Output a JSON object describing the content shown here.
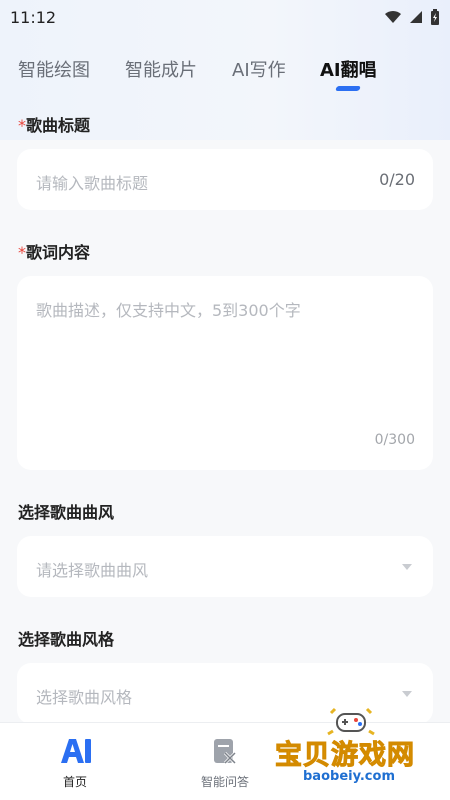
{
  "status": {
    "time": "11:12"
  },
  "tabs": [
    {
      "label": "智能绘图"
    },
    {
      "label": "智能成片"
    },
    {
      "label": "AI写作"
    },
    {
      "label": "AI翻唱"
    }
  ],
  "form": {
    "title": {
      "required_mark": "*",
      "label": "歌曲标题",
      "placeholder": "请输入歌曲标题",
      "counter": "0/20"
    },
    "lyrics": {
      "required_mark": "*",
      "label": "歌词内容",
      "placeholder": "歌曲描述，仅支持中文，5到300个字",
      "counter": "0/300"
    },
    "genre": {
      "label": "选择歌曲曲风",
      "placeholder": "请选择歌曲曲风"
    },
    "style": {
      "label": "选择歌曲风格",
      "placeholder": "选择歌曲风格"
    }
  },
  "bottom_nav": [
    {
      "label": "首页",
      "icon": "ai-home-icon"
    },
    {
      "label": "智能问答",
      "icon": "qa-doc-icon"
    }
  ],
  "watermark": {
    "title": "宝贝游戏网",
    "url": "baobeiy.com"
  },
  "colors": {
    "accent": "#2b6ff2",
    "required": "#e8453c",
    "placeholder": "#b5b8be"
  }
}
